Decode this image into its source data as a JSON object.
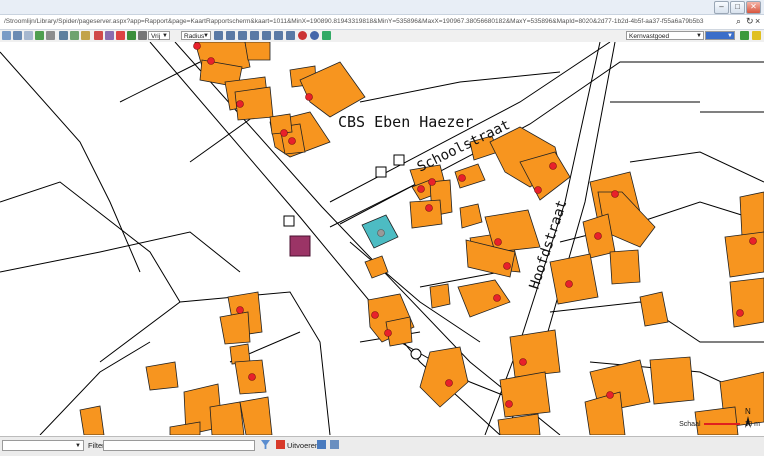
{
  "browser": {
    "address": "/Stroomlijn/Library/Spider/pageserver.aspx?app=Rapport&page=KaartRapportscherm&kaart=1011&MinX=190890.81943319818&MinY=535896&MaxX=190967.38056680182&MaxY=535896&MapId=8020&2d77-1b2d-4b5f-aa37-f55a6a79b5b3",
    "minimize": "–",
    "maximize": "□",
    "close": "✕"
  },
  "toolbar": {
    "select_vrij": "Vrij",
    "select_radius": "Radius",
    "layer_select": "Kernvastgoed",
    "layer_value": ""
  },
  "map": {
    "labels": {
      "cbs": "CBS  Eben Haezer",
      "schoolstraat": "Schoolstraat",
      "hoofdstraat": "Hoofdstraat"
    },
    "north": "N",
    "scale_label": "Schaal",
    "scale_value": "10 m"
  },
  "bottombar": {
    "filter_label": "Filter",
    "filter_value": "",
    "execute_label": "Uitvoeren",
    "dropdown_value": ""
  },
  "colors": {
    "building": "#f7951f",
    "marker": "#e8212b",
    "highlight_teal": "#4dbcc3",
    "selection_purple": "#9b3466",
    "scalebar": "#e0201f"
  }
}
